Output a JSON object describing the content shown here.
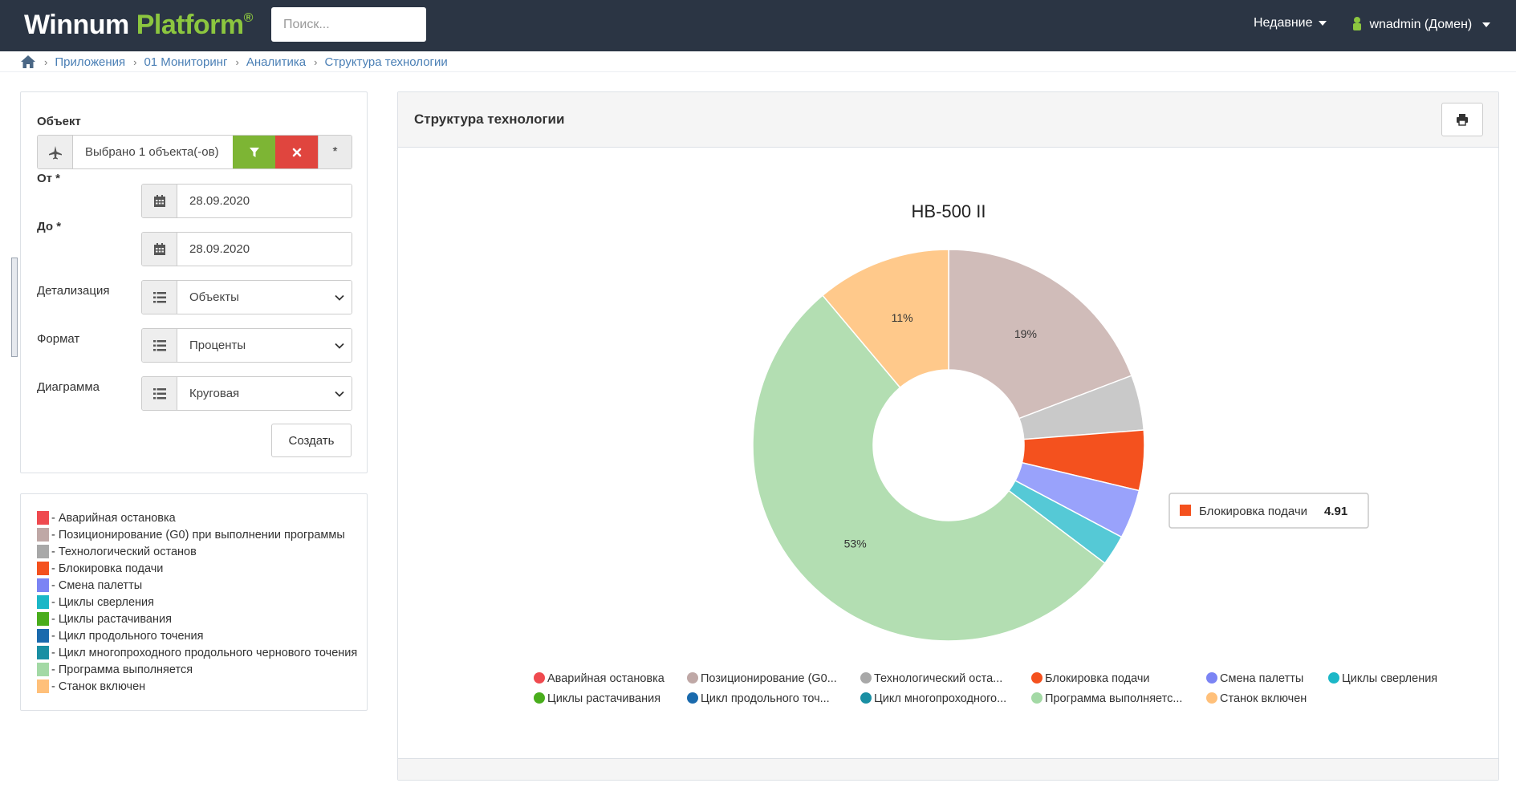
{
  "header": {
    "brand_main": "Winnum",
    "brand_accent": "Platform",
    "brand_mark": "®",
    "search_placeholder": "Поиск...",
    "recent_label": "Недавние",
    "user_label": "wnadmin (Домен)"
  },
  "breadcrumb": {
    "items": [
      {
        "label": "Приложения"
      },
      {
        "label": "01 Мониторинг"
      },
      {
        "label": "Аналитика"
      },
      {
        "label": "Структура технологии"
      }
    ]
  },
  "form": {
    "object_label": "Объект",
    "object_value": "Выбрано 1 объекта(-ов)",
    "all_symbol": "*",
    "from_label": "От *",
    "from_value": "28.09.2020",
    "to_label": "До *",
    "to_value": "28.09.2020",
    "detail_label": "Детализация",
    "detail_value": "Объекты",
    "format_label": "Формат",
    "format_value": "Проценты",
    "diagram_label": "Диаграмма",
    "diagram_value": "Круговая",
    "create_label": "Создать"
  },
  "legend": {
    "items": [
      {
        "label": "- Аварийная остановка",
        "color": "#ef4a4f"
      },
      {
        "label": "- Позиционирование (G0) при выполнении программы",
        "color": "#bfa8a6"
      },
      {
        "label": "- Технологический останов",
        "color": "#a8a8a8"
      },
      {
        "label": "- Блокировка подачи",
        "color": "#f4511e"
      },
      {
        "label": "- Смена палетты",
        "color": "#7b84f4"
      },
      {
        "label": "- Циклы сверления",
        "color": "#1bb7c7"
      },
      {
        "label": "- Циклы растачивания",
        "color": "#49ad1c"
      },
      {
        "label": "- Цикл продольного точения",
        "color": "#1a6aad"
      },
      {
        "label": "- Цикл многопроходного продольного чернового точения",
        "color": "#1a8fa3"
      },
      {
        "label": "- Программа выполняется",
        "color": "#a3d9a5"
      },
      {
        "label": "- Станок включен",
        "color": "#ffc07a"
      }
    ]
  },
  "chart_panel": {
    "title": "Структура технологии"
  },
  "chart_data": {
    "type": "pie",
    "title": "HB-500 II",
    "unit": "%",
    "slices": [
      {
        "name": "Позиционирование (G0...",
        "value": 19,
        "color": "#d0bcb9",
        "label": "19%"
      },
      {
        "name": "Технологический оста...",
        "value": 4.5,
        "color": "#c9c9c9",
        "label": ""
      },
      {
        "name": "Блокировка подачи",
        "value": 4.91,
        "color": "#f4511e",
        "label": ""
      },
      {
        "name": "Смена палетты",
        "value": 4.0,
        "color": "#99a2fb",
        "label": ""
      },
      {
        "name": "Циклы сверления",
        "value": 2.5,
        "color": "#55c9d6",
        "label": ""
      },
      {
        "name": "Программа выполняетс...",
        "value": 53,
        "color": "#b3deb2",
        "label": "53%"
      },
      {
        "name": "Станок включен",
        "value": 11,
        "color": "#ffc98b",
        "label": "11%"
      }
    ],
    "tooltip": {
      "name": "Блокировка подачи",
      "value": "4.91",
      "color": "#f4511e"
    },
    "legend": [
      {
        "name": "Аварийная остановка",
        "color": "#ef4a4f"
      },
      {
        "name": "Позиционирование (G0...",
        "color": "#bfa8a6"
      },
      {
        "name": "Технологический оста...",
        "color": "#a8a8a8"
      },
      {
        "name": "Блокировка подачи",
        "color": "#f4511e"
      },
      {
        "name": "Смена палетты",
        "color": "#7b84f4"
      },
      {
        "name": "Циклы сверления",
        "color": "#1bb7c7"
      },
      {
        "name": "Циклы растачивания",
        "color": "#49ad1c"
      },
      {
        "name": "Цикл продольного точ...",
        "color": "#1a6aad"
      },
      {
        "name": "Цикл многопроходного...",
        "color": "#1a8fa3"
      },
      {
        "name": "Программа выполняетс...",
        "color": "#a3d9a5"
      },
      {
        "name": "Станок включен",
        "color": "#ffc07a"
      }
    ]
  }
}
